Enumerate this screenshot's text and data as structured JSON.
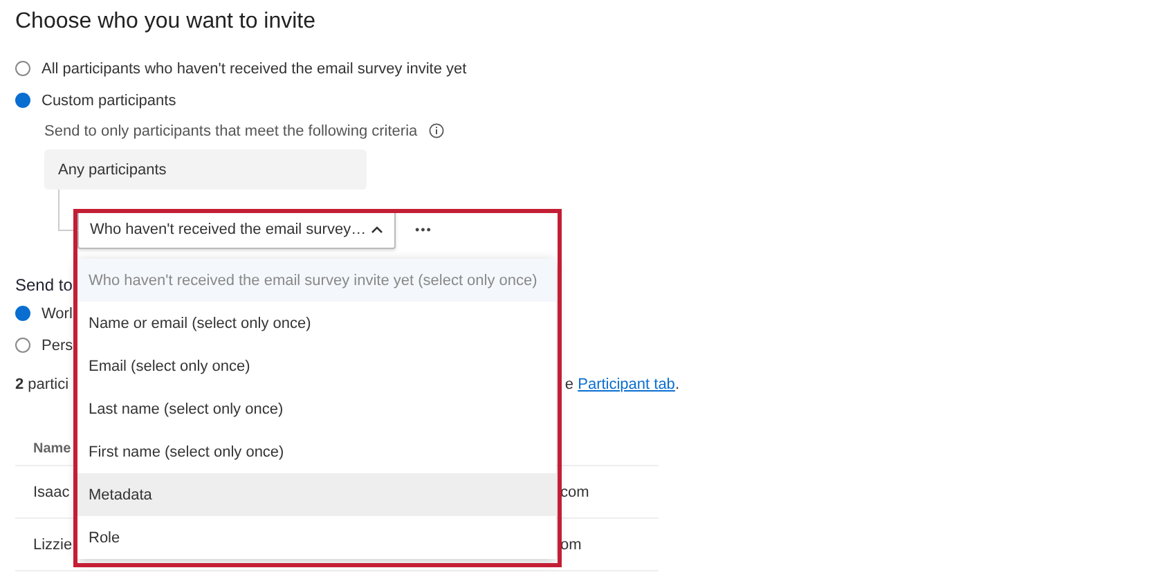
{
  "heading": "Choose who you want to invite",
  "invite_options": [
    {
      "label": "All participants who haven't received the email survey invite yet",
      "selected": false
    },
    {
      "label": "Custom participants",
      "selected": true
    }
  ],
  "criteria": {
    "label": "Send to only participants that meet the following criteria",
    "group": "Any participants",
    "dropdown": {
      "value": "Who haven't received the email survey…",
      "expanded": true
    },
    "more": "•••"
  },
  "menu": [
    {
      "label": "Who haven't received the email survey invite yet (select only once)",
      "selected": true,
      "hovered": false
    },
    {
      "label": "Name or email (select only once)",
      "selected": false,
      "hovered": false
    },
    {
      "label": "Email (select only once)",
      "selected": false,
      "hovered": false
    },
    {
      "label": "Last name (select only once)",
      "selected": false,
      "hovered": false
    },
    {
      "label": "First name (select only once)",
      "selected": false,
      "hovered": false
    },
    {
      "label": "Metadata",
      "selected": false,
      "hovered": true
    },
    {
      "label": "Role",
      "selected": false,
      "hovered": false
    }
  ],
  "send_to": {
    "heading": "Send to",
    "options": [
      {
        "label": "Worl",
        "selected": true
      },
      {
        "label": "Pers",
        "selected": false
      }
    ]
  },
  "summary": {
    "left": "**2** partici",
    "right_prefix": "e",
    "link": "Participant tab",
    "right_suffix": "."
  },
  "table": {
    "columns": [
      "Name"
    ],
    "rows": [
      [
        "Isaac",
        "com"
      ],
      [
        "Lizzie",
        "om"
      ]
    ]
  }
}
